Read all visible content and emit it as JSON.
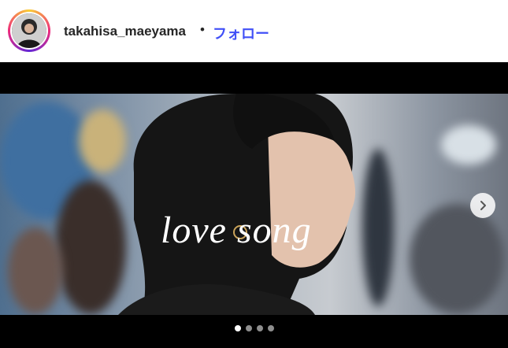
{
  "header": {
    "username": "takahisa_maeyama",
    "separator": "•",
    "follow_label": "フォロー"
  },
  "media": {
    "caption": "love song",
    "pagination": {
      "total": 4,
      "active": 1
    },
    "next_icon": "chevron-right-icon"
  },
  "colors": {
    "follow": "#4150f7",
    "text": "#262626"
  }
}
